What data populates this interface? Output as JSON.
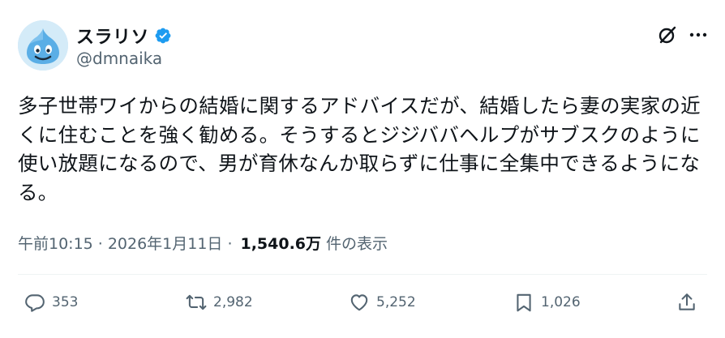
{
  "author": {
    "display_name": "スラリソ",
    "handle": "@dmnaika",
    "verified": true,
    "avatar_icon": "slime-avatar-icon"
  },
  "colors": {
    "verified_blue": "#1d9bf0",
    "text_primary": "#0f1419",
    "text_secondary": "#536471"
  },
  "header_icons": [
    "grok-icon",
    "more-icon"
  ],
  "tweet": {
    "text": "多子世帯ワイからの結婚に関するアドバイスだが、結婚したら妻の実家の近くに住むことを強く勧める。そうするとジジババヘルプがサブスクのように使い放題になるので、男が育休なんか取らずに仕事に全集中できるようになる。",
    "time": "午前10:15",
    "date": "2026年1月11日",
    "separator": "·",
    "views_count": "1,540.6万",
    "views_label": "件の表示"
  },
  "actions": {
    "replies": "353",
    "retweets": "2,982",
    "likes": "5,252",
    "bookmarks": "1,026"
  }
}
